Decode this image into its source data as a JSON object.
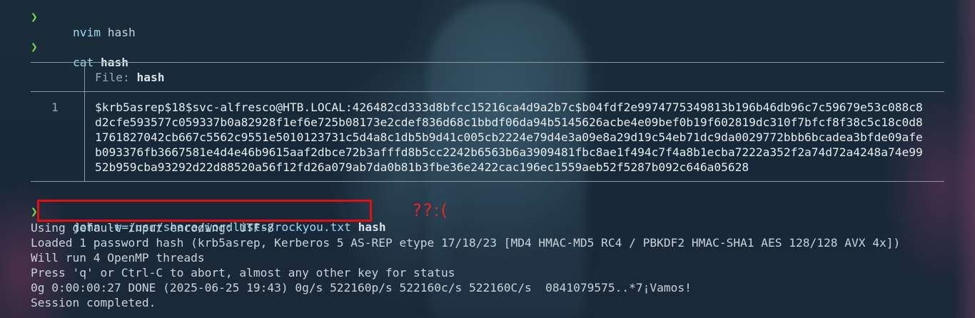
{
  "prompt_symbol": "❯",
  "lines": {
    "nvim": {
      "cmd": "nvim",
      "arg": "hash"
    },
    "cat": {
      "cmd": "cat",
      "arg": "hash"
    },
    "john": {
      "cmd": "john",
      "arg": "-w=/usr/share/wordlists/rockyou.txt",
      "file": "hash"
    }
  },
  "bat": {
    "file_label": "File:",
    "file_name": "hash",
    "line_number": "1",
    "hash_lines": [
      "$krb5asrep$18$svc-alfresco@HTB.LOCAL:426482cd333d8bfcc15216ca4d9a2b7c$b04fdf2e9974775349813b196b46db96c7c59679e53c088c8",
      "d2cfe593577c059337b0a82928f1ef6e725b08173e2cdef836d68c1bbdf06da94b5145626acbe4e09bef0b19f602819dc310f7bfcf8f38c5c18c0d8",
      "1761827042cb667c5562c9551e5010123731c5d4a8c1db5b9d41c005cb2224e79d4e3a09e8a29d19c54eb71dc9da0029772bbb6bcadea3bfde09afe",
      "b093376fb3667581e4d4e46b9615aaf2dbce72b3afffd8b5cc2242b6563b6a3909481fbc8ae1f494c7f4a8b1ecba7222a352f2a74d72a4248a74e99",
      "52b959cba93292d22d88520a56f12fd26a079ab7da0b81b3fbe36e2422cac196ec1559aeb52f5287b092c646a05628"
    ]
  },
  "annotation": "??:(",
  "output": [
    "Using default input encoding: UTF-8",
    "Loaded 1 password hash (krb5asrep, Kerberos 5 AS-REP etype 17/18/23 [MD4 HMAC-MD5 RC4 / PBKDF2 HMAC-SHA1 AES 128/128 AVX 4x])",
    "Will run 4 OpenMP threads",
    "Press 'q' or Ctrl-C to abort, almost any other key for status",
    "0g 0:00:00:27 DONE (2025-06-25 19:43) 0g/s 522160p/s 522160c/s 522160C/s  0841079575..*7¡Vamos!",
    "Session completed."
  ],
  "colors": {
    "prompt": "#79d94b",
    "command": "#9ed8f0",
    "highlight_box": "#e01010"
  }
}
